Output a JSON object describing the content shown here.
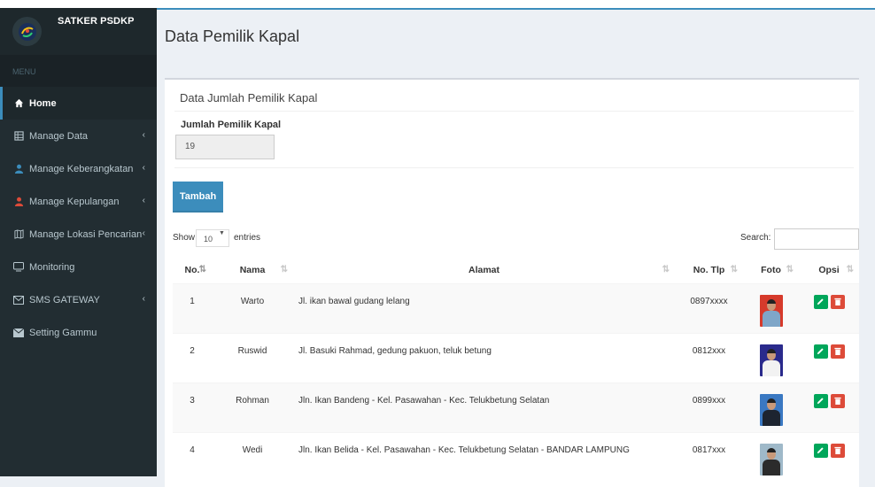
{
  "sidebar": {
    "brand": "SATKER PSDKP",
    "menu_header": "MENU",
    "items": [
      {
        "label": "Home",
        "icon": "home-icon"
      },
      {
        "label": "Manage Data",
        "icon": "table-icon"
      },
      {
        "label": "Manage Keberangkatan",
        "icon": "user-icon"
      },
      {
        "label": "Manage Kepulangan",
        "icon": "user-icon"
      },
      {
        "label": "Manage Lokasi Pencarian",
        "icon": "map-icon"
      },
      {
        "label": "Monitoring",
        "icon": "monitor-icon"
      },
      {
        "label": "SMS GATEWAY",
        "icon": "envelope-icon"
      },
      {
        "label": "Setting Gammu",
        "icon": "envelope-icon"
      }
    ]
  },
  "page": {
    "title": "Data Pemilik Kapal",
    "section_title": "Data Jumlah Pemilik Kapal",
    "count_label": "Jumlah Pemilik Kapal",
    "count_value": "19",
    "add_button": "Tambah"
  },
  "table_controls": {
    "show": "Show",
    "entries_value": "10",
    "entries": "entries",
    "search_label": "Search:"
  },
  "table": {
    "columns": [
      "No.",
      "Nama",
      "Alamat",
      "No. Tlp",
      "Foto",
      "Opsi"
    ],
    "rows": [
      {
        "no": "1",
        "nama": "Warto",
        "alamat": "Jl. ikan bawal gudang lelang",
        "tlp": "0897xxxx"
      },
      {
        "no": "2",
        "nama": "Ruswid",
        "alamat": "Jl. Basuki Rahmad, gedung pakuon, teluk betung",
        "tlp": "0812xxx"
      },
      {
        "no": "3",
        "nama": "Rohman",
        "alamat": "Jln. Ikan Bandeng - Kel. Pasawahan - Kec. Telukbetung Selatan",
        "tlp": "0899xxx"
      },
      {
        "no": "4",
        "nama": "Wedi",
        "alamat": "Jln. Ikan Belida - Kel. Pasawahan - Kec. Telukbetung Selatan - BANDAR LAMPUNG",
        "tlp": "0817xxx"
      }
    ]
  },
  "colors": {
    "primary": "#3c8dbc",
    "sidebar": "#222d32",
    "edit": "#00a65a",
    "delete": "#dd4b39"
  }
}
